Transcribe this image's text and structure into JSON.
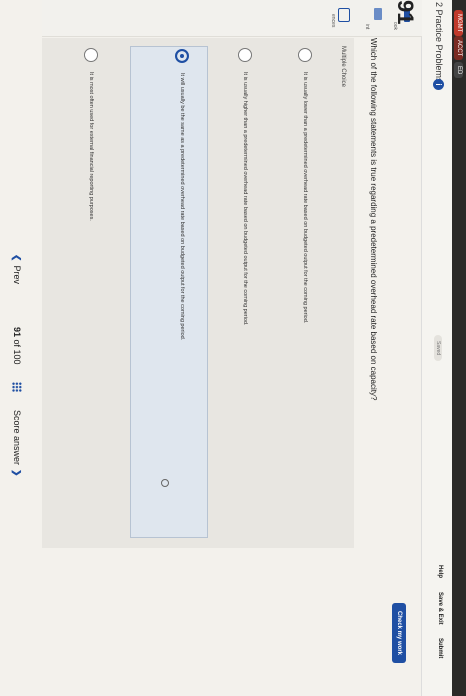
{
  "browser": {
    "tabs": [
      "MGMT",
      "ACCT",
      "ED"
    ]
  },
  "header": {
    "section_title": "2 Practice Problems",
    "info_icon": "i",
    "saved_label": "Saved",
    "help": "Help",
    "save_exit": "Save & Exit",
    "submit": "Submit"
  },
  "sidebar": {
    "items": [
      {
        "label": "ook",
        "icon": "ebook-icon"
      },
      {
        "label": "int",
        "icon": "print-icon"
      },
      {
        "label": "ences",
        "icon": "references-icon"
      }
    ]
  },
  "question": {
    "number": "91",
    "check_work": "Check my work",
    "text": "Which of the following statements is true regarding a predetermined overhead rate based on capacity?",
    "type_label": "Multiple Choice",
    "options": [
      {
        "text": "It is usually lower than a predetermined overhead rate based on budgeted output for the coming period.",
        "selected": false
      },
      {
        "text": "It is usually higher than a predetermined overhead rate based on budgeted output for the coming period.",
        "selected": false
      },
      {
        "text": "It will usually be the same as a predetermined overhead rate based on budgeted output for the coming period.",
        "selected": true
      },
      {
        "text": "It is most often used for external financial reporting purposes.",
        "selected": false
      }
    ]
  },
  "footer": {
    "prev": "Prev",
    "current": "91",
    "of": "of 100",
    "next": "Score answer"
  },
  "colors": {
    "accent": "#1f4fa3",
    "background": "#f3f1ec"
  }
}
